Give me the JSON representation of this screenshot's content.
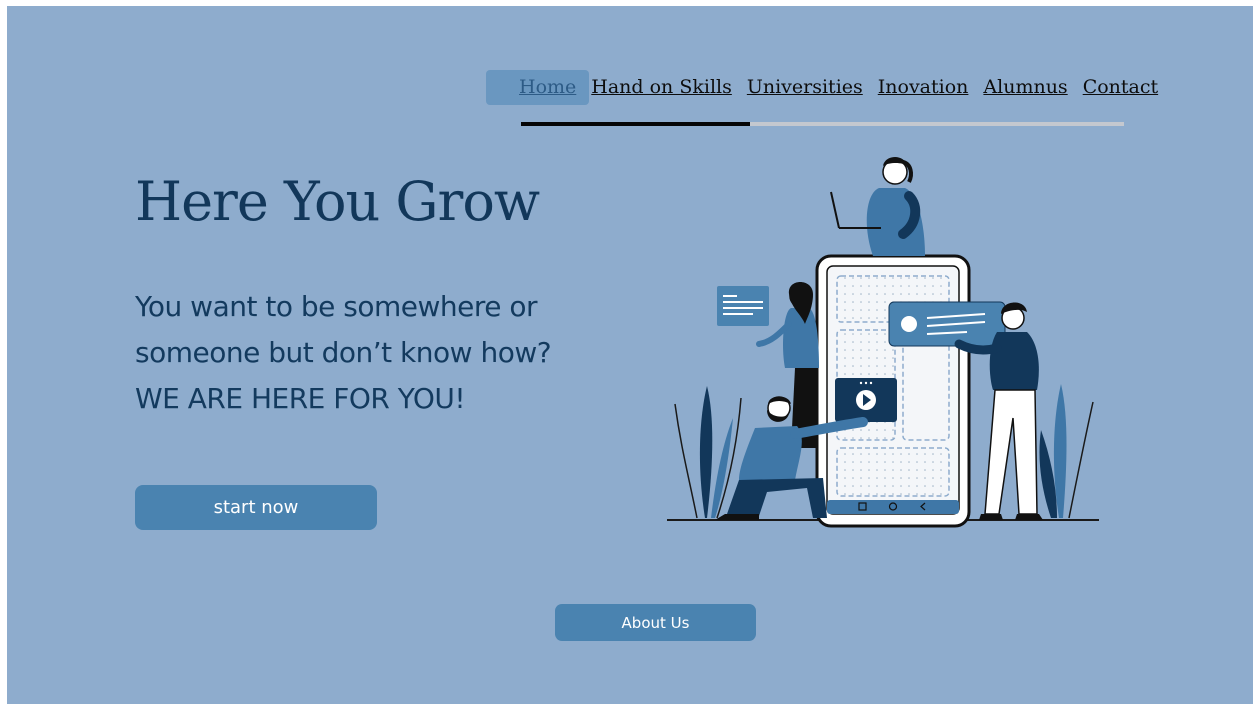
{
  "nav": {
    "items": [
      "Home",
      "Hand on Skills",
      "Universities",
      "Inovation",
      "Alumnus",
      "Contact"
    ],
    "active_index": 0,
    "progress_fraction": 0.38
  },
  "hero": {
    "title": "Here You Grow",
    "subtitle_line1": "You want to be somewhere or",
    "subtitle_line2": "someone but don’t know how?",
    "subtitle_line3": "WE ARE HERE FOR YOU!",
    "cta_label": "start now"
  },
  "about": {
    "label": "About Us"
  },
  "colors": {
    "background": "#8eaccd",
    "accent_button": "#4a83b0",
    "title_text": "#12375a",
    "nav_active_bg": "#6a97c0",
    "illustration_primary": "#3f77a7",
    "illustration_dark": "#12375a"
  },
  "illustration": {
    "icons": [
      "people-phone-illustration",
      "play-icon",
      "chat-bubble-icon",
      "text-card-icon",
      "laptop-icon",
      "plant-icon"
    ]
  }
}
